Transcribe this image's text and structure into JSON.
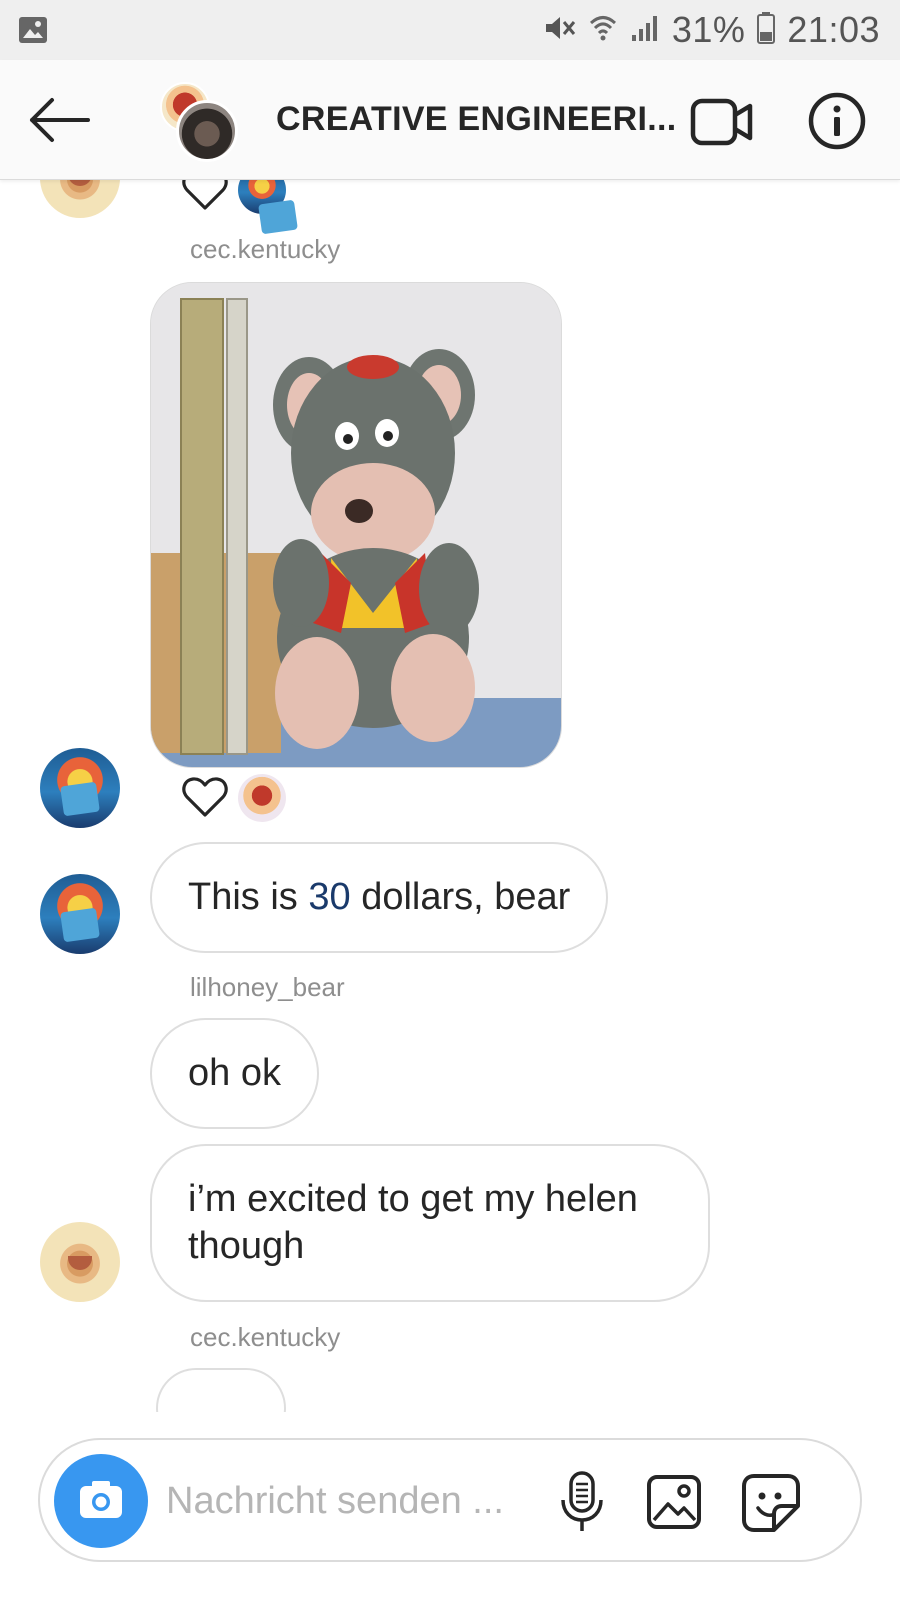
{
  "status_bar": {
    "battery": "31%",
    "time": "21:03",
    "icons": [
      "image-icon",
      "mute-icon",
      "wifi-icon",
      "signal-icon",
      "battery-icon"
    ]
  },
  "header": {
    "title": "CREATIVE ENGINEERI...",
    "icons": [
      "back-arrow-icon",
      "video-call-icon",
      "info-icon"
    ]
  },
  "messages": [
    {
      "type": "reaction_row",
      "sender": "",
      "heart_icon": "heart-outline-icon"
    },
    {
      "type": "photo",
      "sender_label": "cec.kentucky",
      "image": "plush-mouse-photo"
    },
    {
      "type": "text",
      "parts": [
        "This is ",
        "30",
        " dollars, bear"
      ]
    },
    {
      "type": "text",
      "sender_label": "lilhoney_bear",
      "text": "oh ok"
    },
    {
      "type": "text",
      "text": "i’m excited to get my helen though"
    },
    {
      "type": "label",
      "sender_label": "cec.kentucky"
    }
  ],
  "composer": {
    "placeholder": "Nachricht senden ...",
    "icons": [
      "camera-icon",
      "microphone-icon",
      "gallery-icon",
      "sticker-icon"
    ]
  },
  "colors": {
    "accent": "#3897f0",
    "bubble_border": "#dedede",
    "meta_text": "#8e8e8e",
    "number_link": "#1a3a6b"
  }
}
